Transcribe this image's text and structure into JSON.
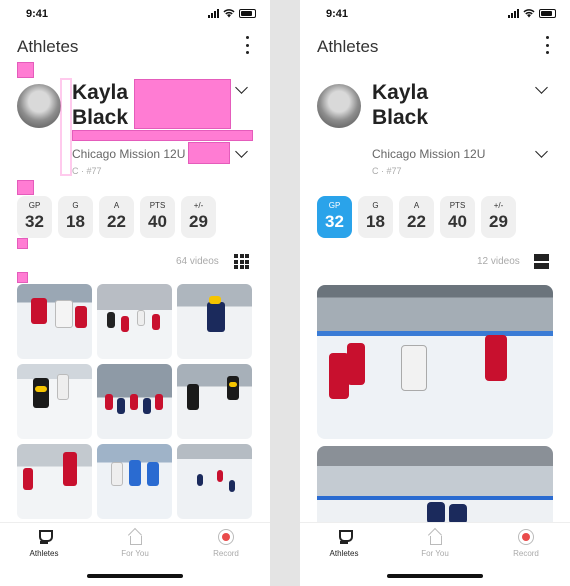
{
  "colors": {
    "accent": "#2aa3ea",
    "record": "#e94b4b",
    "redaction": "#ff66cc"
  },
  "screens": [
    {
      "status": {
        "time": "9:41"
      },
      "header": {
        "title": "Athletes",
        "menu_icon": "more-vertical-icon"
      },
      "athlete": {
        "first_name": "Kayla",
        "last_name": "Black",
        "team": "Chicago Mission 12U",
        "position": "C · #77"
      },
      "stats": [
        {
          "label": "GP",
          "value": "32",
          "selected": false
        },
        {
          "label": "G",
          "value": "18",
          "selected": false
        },
        {
          "label": "A",
          "value": "22",
          "selected": false
        },
        {
          "label": "PTS",
          "value": "40",
          "selected": false
        },
        {
          "label": "+/-",
          "value": "29",
          "selected": false
        }
      ],
      "videos": {
        "count_label": "64 videos",
        "view_icon": "grid-view-icon"
      },
      "tabs": [
        {
          "label": "Athletes",
          "icon": "trophy-icon",
          "active": true
        },
        {
          "label": "For You",
          "icon": "home-icon",
          "active": false
        },
        {
          "label": "Record",
          "icon": "record-icon",
          "active": false
        }
      ]
    },
    {
      "status": {
        "time": "9:41"
      },
      "header": {
        "title": "Athletes",
        "menu_icon": "more-vertical-icon"
      },
      "athlete": {
        "first_name": "Kayla",
        "last_name": "Black",
        "team": "Chicago Mission 12U",
        "position": "C · #77"
      },
      "stats": [
        {
          "label": "GP",
          "value": "32",
          "selected": true
        },
        {
          "label": "G",
          "value": "18",
          "selected": false
        },
        {
          "label": "A",
          "value": "22",
          "selected": false
        },
        {
          "label": "PTS",
          "value": "40",
          "selected": false
        },
        {
          "label": "+/-",
          "value": "29",
          "selected": false
        }
      ],
      "videos": {
        "count_label": "12 videos",
        "view_icon": "list-view-icon"
      },
      "tabs": [
        {
          "label": "Athletes",
          "icon": "trophy-icon",
          "active": true
        },
        {
          "label": "For You",
          "icon": "home-icon",
          "active": false
        },
        {
          "label": "Record",
          "icon": "record-icon",
          "active": false
        }
      ]
    }
  ]
}
